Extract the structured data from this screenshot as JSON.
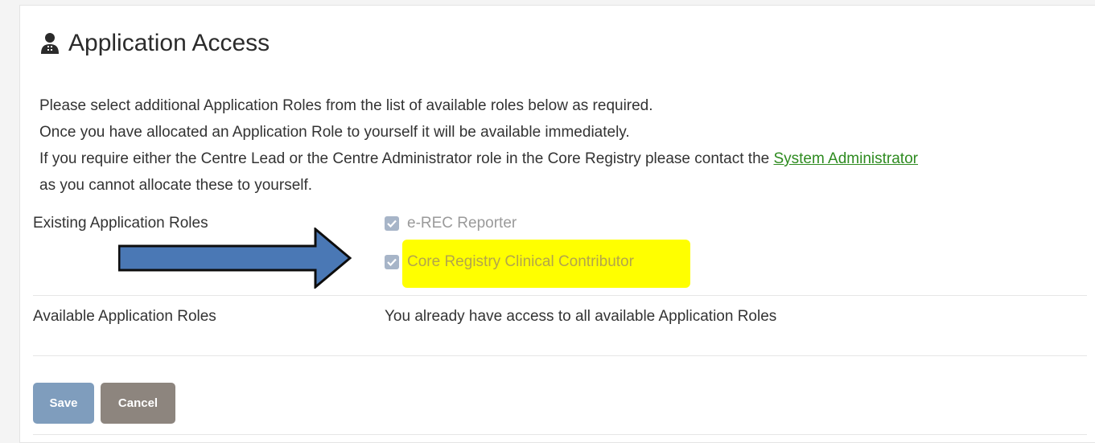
{
  "page": {
    "title": "Application Access",
    "title_icon": "user-doctor-icon"
  },
  "intro": {
    "line1": "Please select additional Application Roles from the list of available roles below as required.",
    "line2": "Once you have allocated an Application Role to yourself it will be available immediately.",
    "line3_prefix": "If you require either the Centre Lead or the Centre Administrator role in the Core Registry please contact the ",
    "line3_link": "System Administrator",
    "line4": "as you cannot allocate these to yourself."
  },
  "existing": {
    "label": "Existing Application Roles",
    "roles": [
      {
        "label": "e-REC Reporter",
        "checked": true,
        "disabled": true
      },
      {
        "label": "Core Registry Clinical Contributor",
        "checked": true,
        "disabled": true,
        "highlighted": true
      }
    ]
  },
  "available": {
    "label": "Available Application Roles",
    "message": "You already have access to all available Application Roles"
  },
  "buttons": {
    "save": "Save",
    "cancel": "Cancel"
  },
  "annotation": {
    "arrow_color": "#4a78b5",
    "highlight_color": "#ffff00"
  },
  "colors": {
    "link": "#2e8b20",
    "save_button": "#7f9dbd",
    "cancel_button": "#8d857e",
    "checkbox": "#a7b5c8"
  }
}
